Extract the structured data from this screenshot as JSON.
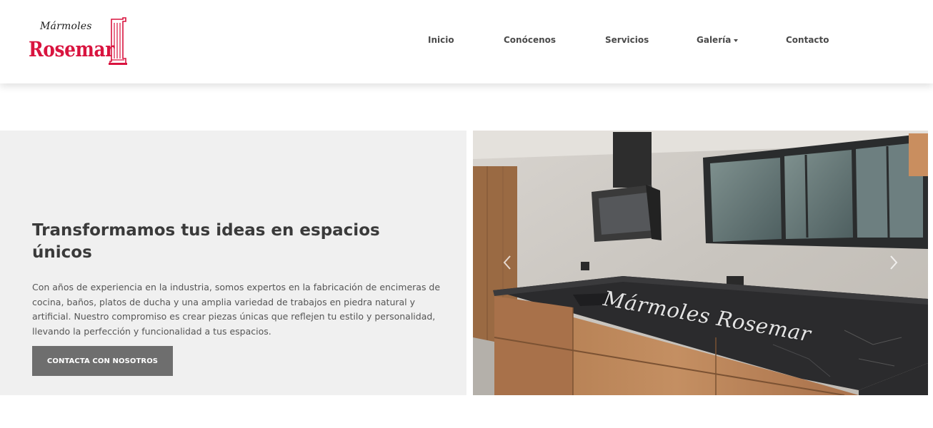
{
  "brand": {
    "line1": "Mármoles",
    "line2": "Rosemar",
    "logo_color": "#d9143f"
  },
  "nav": {
    "items": [
      {
        "label": "Inicio"
      },
      {
        "label": "Conócenos"
      },
      {
        "label": "Servicios"
      },
      {
        "label": "Galería",
        "has_dropdown": true
      },
      {
        "label": "Contacto"
      }
    ]
  },
  "hero": {
    "title": "Transformamos tus ideas en espacios únicos",
    "text": "Con años de experiencia en la industria, somos expertos en la fabricación de encimeras de cocina, baños, platos de ducha y una amplia variedad de trabajos en piedra natural y artificial. Nuestro compromiso es crear piezas únicas que reflejen tu estilo y personalidad, llevando la perfección y funcionalidad a tus espacios.",
    "button_label": "CONTACTA CON NOSOTROS",
    "button_color": "#6e6e6e",
    "panel_color": "#f0f0f0"
  },
  "carousel": {
    "watermark": "Mármoles Rosemar",
    "prev_icon": "chevron-left-icon",
    "next_icon": "chevron-right-icon"
  }
}
